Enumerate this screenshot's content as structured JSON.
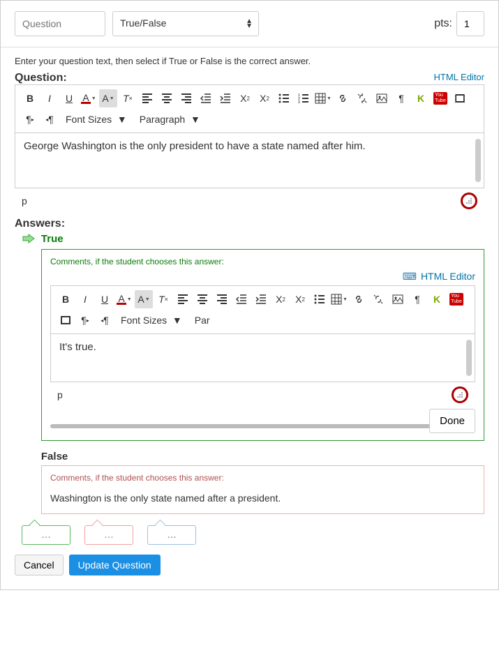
{
  "header": {
    "question_name_placeholder": "Question",
    "question_type": "True/False",
    "pts_label": "pts:",
    "pts_value": "1"
  },
  "instruction": "Enter your question text, then select if True or False is the correct answer.",
  "question_label": "Question:",
  "html_editor_link": "HTML Editor",
  "toolbar": {
    "font_sizes": "Font Sizes",
    "paragraph": "Paragraph"
  },
  "question_text": "George Washington is the only president to have a state named after him.",
  "status_p": "p",
  "answers_label": "Answers:",
  "true_answer": {
    "title": "True",
    "comment_label": "Comments, if the student chooses this answer:",
    "comment_text": "It's true.",
    "done": "Done",
    "toolbar_font": "Font Sizes",
    "toolbar_para": "Par"
  },
  "false_answer": {
    "title": "False",
    "comment_label": "Comments, if the student chooses this answer:",
    "comment_text": "Washington is the only state named after a president."
  },
  "bubbles": {
    "green": "...",
    "red": "...",
    "blue": "..."
  },
  "actions": {
    "cancel": "Cancel",
    "update": "Update Question"
  }
}
